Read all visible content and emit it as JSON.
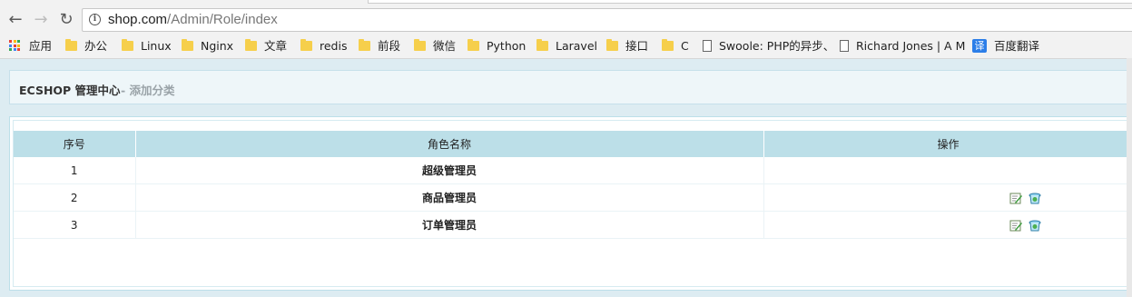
{
  "browser": {
    "url_host": "shop.com",
    "url_path": "/Admin/Role/index",
    "bookmarks": [
      {
        "label": "应用",
        "icon": "apps-icon"
      },
      {
        "label": "办公",
        "icon": "folder-icon"
      },
      {
        "label": "Linux",
        "icon": "folder-icon"
      },
      {
        "label": "Nginx",
        "icon": "folder-icon"
      },
      {
        "label": "文章",
        "icon": "folder-icon"
      },
      {
        "label": "redis",
        "icon": "folder-icon"
      },
      {
        "label": "前段",
        "icon": "folder-icon"
      },
      {
        "label": "微信",
        "icon": "folder-icon"
      },
      {
        "label": "Python",
        "icon": "folder-icon"
      },
      {
        "label": "Laravel",
        "icon": "folder-icon"
      },
      {
        "label": "接口",
        "icon": "folder-icon"
      },
      {
        "label": "C",
        "icon": "folder-icon"
      },
      {
        "label": "Swoole: PHP的异步、",
        "icon": "page-icon"
      },
      {
        "label": "Richard Jones | A M",
        "icon": "page-icon"
      },
      {
        "label": "百度翻译",
        "icon": "translate-icon",
        "glyph": "译"
      }
    ]
  },
  "header": {
    "app_title": "ECSHOP 管理中心",
    "section": "- 添加分类"
  },
  "table": {
    "columns": [
      "序号",
      "角色名称",
      "操作"
    ],
    "rows": [
      {
        "id": "1",
        "name": "超级管理员",
        "actions": false
      },
      {
        "id": "2",
        "name": "商品管理员",
        "actions": true
      },
      {
        "id": "3",
        "name": "订单管理员",
        "actions": true
      }
    ]
  },
  "colors": {
    "table_header_bg": "#bcdfe8",
    "page_bg": "#ddecf2",
    "folder": "#f6cf4b"
  }
}
